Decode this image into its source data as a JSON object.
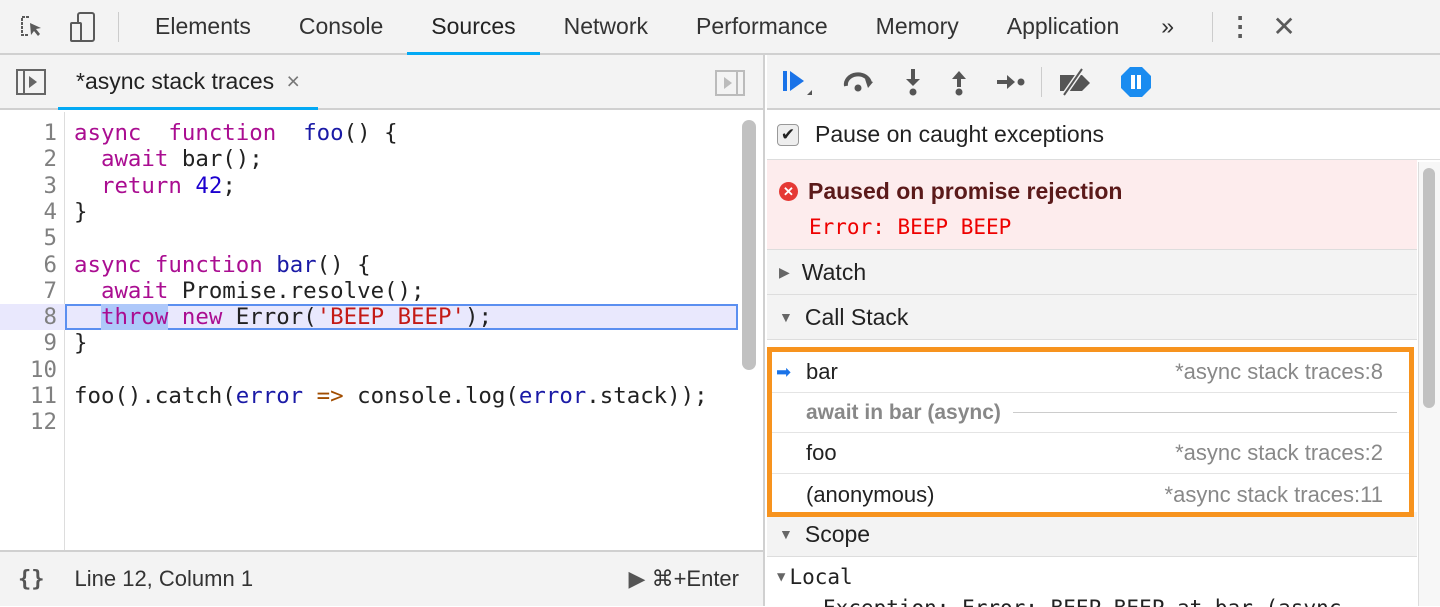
{
  "tabs": [
    "Elements",
    "Console",
    "Sources",
    "Network",
    "Performance",
    "Memory",
    "Application"
  ],
  "active_tab": "Sources",
  "more_tabs": "»",
  "file_tab": {
    "label": "*async stack traces",
    "close": "×"
  },
  "code_lines": [
    [
      [
        "kw",
        "async"
      ],
      [
        "",
        "  "
      ],
      [
        "kw",
        "function"
      ],
      [
        "",
        "  "
      ],
      [
        "def",
        "foo"
      ],
      [
        "",
        "() {"
      ]
    ],
    [
      [
        "",
        "  "
      ],
      [
        "kw",
        "await"
      ],
      [
        "",
        " bar();"
      ]
    ],
    [
      [
        "",
        "  "
      ],
      [
        "kw",
        "return"
      ],
      [
        "",
        " "
      ],
      [
        "num",
        "42"
      ],
      [
        "",
        ";"
      ]
    ],
    [
      [
        "",
        "}"
      ]
    ],
    [],
    [
      [
        "kw",
        "async"
      ],
      [
        "",
        " "
      ],
      [
        "kw",
        "function"
      ],
      [
        "",
        " "
      ],
      [
        "def",
        "bar"
      ],
      [
        "",
        "() {"
      ]
    ],
    [
      [
        "",
        "  "
      ],
      [
        "kw",
        "await"
      ],
      [
        "",
        " Promise.resolve();"
      ]
    ],
    [
      [
        "",
        "  "
      ],
      [
        "kw sel",
        "throw"
      ],
      [
        "",
        " "
      ],
      [
        "kw",
        "new"
      ],
      [
        "",
        " Error("
      ],
      [
        "str",
        "'BEEP BEEP'"
      ],
      [
        "",
        ");"
      ]
    ],
    [
      [
        "",
        "}"
      ]
    ],
    [],
    [
      [
        "",
        "foo().catch("
      ],
      [
        "var",
        "error"
      ],
      [
        "",
        " "
      ],
      [
        "op",
        "=>"
      ],
      [
        "",
        " console.log("
      ],
      [
        "var",
        "error"
      ],
      [
        "",
        ".stack));"
      ]
    ],
    []
  ],
  "execution_line": 8,
  "status": {
    "position": "Line 12, Column 1",
    "run": "⌘+Enter"
  },
  "pause_on_caught": {
    "label": "Pause on caught exceptions",
    "checked": true
  },
  "paused": {
    "title": "Paused on promise rejection",
    "error": "Error: BEEP BEEP"
  },
  "sections": {
    "watch": "Watch",
    "call_stack": "Call Stack",
    "scope": "Scope",
    "local": "Local"
  },
  "call_stack": [
    {
      "name": "bar",
      "location": "*async stack traces:8",
      "current": true
    },
    {
      "separator": "await in bar (async)"
    },
    {
      "name": "foo",
      "location": "*async stack traces:2"
    },
    {
      "name": "(anonymous)",
      "location": "*async stack traces:11"
    }
  ],
  "local_first": "Exception: Error: BEEP BEEP at bar (async",
  "colors": {
    "accent": "#03a9f4",
    "highlight": "#f7931e",
    "error": "#e53935"
  }
}
